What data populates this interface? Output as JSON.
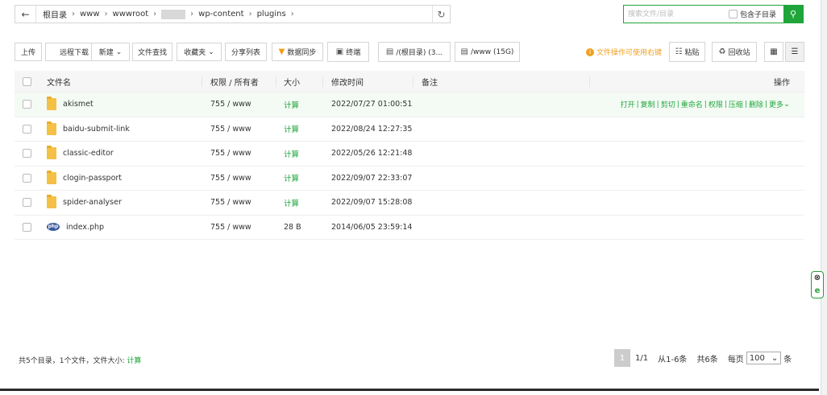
{
  "pathbar": {
    "crumbs": [
      "根目录",
      "www",
      "wwwroot",
      "",
      "wp-content",
      "plugins"
    ]
  },
  "search": {
    "placeholder": "搜索文件/目录",
    "include_subdir_label": "包含子目录"
  },
  "toolbar": {
    "upload": "上传",
    "remote_download": "远程下载",
    "new": "新建",
    "file_search": "文件查找",
    "favorites": "收藏夹",
    "share_list": "分享列表",
    "data_sync": "数据同步",
    "terminal": "终端",
    "disk_root": "/(根目录) (3...",
    "disk_www": "/www (15G)",
    "tip": "文件操作可使用右键",
    "paste": "粘贴",
    "recycle": "回收站"
  },
  "table": {
    "headers": {
      "name": "文件名",
      "perm": "权限 / 所有者",
      "size": "大小",
      "mtime": "修改时间",
      "note": "备注",
      "ops": "操作"
    },
    "rows": [
      {
        "name": "akismet",
        "type": "folder",
        "perm": "755 / www",
        "size": "计算",
        "mtime": "2022/07/27 01:00:51"
      },
      {
        "name": "baidu-submit-link",
        "type": "folder",
        "perm": "755 / www",
        "size": "计算",
        "mtime": "2022/08/24 12:27:35"
      },
      {
        "name": "classic-editor",
        "type": "folder",
        "perm": "755 / www",
        "size": "计算",
        "mtime": "2022/05/26 12:21:48"
      },
      {
        "name": "clogin-passport",
        "type": "folder",
        "perm": "755 / www",
        "size": "计算",
        "mtime": "2022/09/07 22:33:07"
      },
      {
        "name": "spider-analyser",
        "type": "folder",
        "perm": "755 / www",
        "size": "计算",
        "mtime": "2022/09/07 15:28:08"
      },
      {
        "name": "index.php",
        "type": "php",
        "perm": "755 / www",
        "size": "28 B",
        "mtime": "2014/06/05 23:59:14"
      }
    ],
    "row_ops": [
      "打开",
      "复制",
      "剪切",
      "重命名",
      "权限",
      "压缩",
      "删除",
      "更多"
    ]
  },
  "footer": {
    "summary": "共5个目录，1个文件，文件大小:",
    "calc": "计算"
  },
  "pager": {
    "current": "1",
    "pages": "1/1",
    "range": "从1-6条",
    "total": "共6条",
    "per_page_label": "每页",
    "per_page_value": "100",
    "unit": "条"
  },
  "colors": {
    "accent": "#20a53a",
    "warning": "#f0a020"
  }
}
